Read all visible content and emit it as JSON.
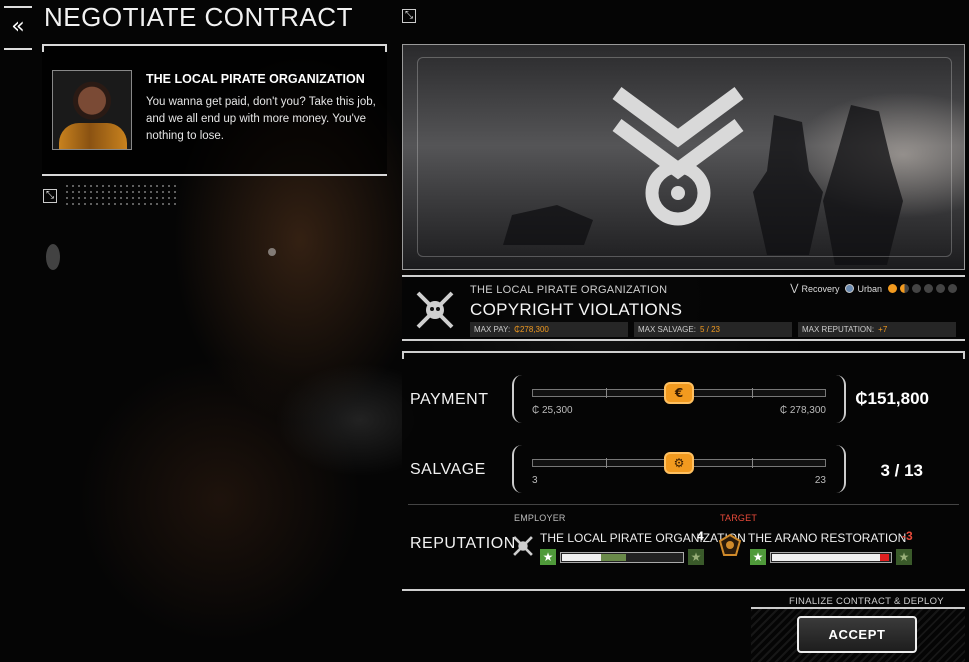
{
  "header": {
    "title": "NEGOTIATE CONTRACT",
    "back_glyph": "«"
  },
  "dialog": {
    "speaker": "THE LOCAL PIRATE ORGANIZATION",
    "text": "You wanna get paid, don't you? Take this job, and we all end up with more money. You've nothing to lose."
  },
  "contract": {
    "org": "THE LOCAL PIRATE ORGANIZATION",
    "title": "COPYRIGHT VIOLATIONS",
    "tags": {
      "type": "Recovery",
      "biome": "Urban"
    },
    "difficulty": {
      "filled": 2,
      "total": 6
    },
    "stats": {
      "max_pay_label": "MAX PAY:",
      "max_pay": "₵278,300",
      "max_salvage_label": "MAX SALVAGE:",
      "max_salvage": "5 / 23",
      "max_rep_label": "MAX REPUTATION:",
      "max_rep": "+7"
    }
  },
  "negotiation": {
    "payment": {
      "label": "PAYMENT",
      "min_label": "₵ 25,300",
      "max_label": "₵ 278,300",
      "value": "₵151,800",
      "min": 25300,
      "max": 278300,
      "current": 151800
    },
    "salvage": {
      "label": "SALVAGE",
      "min_label": "3",
      "max_label": "23",
      "value": "3 / 13",
      "min": 3,
      "max": 23,
      "current": 13
    },
    "reputation": {
      "label": "REPUTATION",
      "employer": {
        "caption": "EMPLOYER",
        "name": "THE LOCAL PIRATE ORGANIZATION",
        "change": "4",
        "level": 0.33,
        "gain": 0.2
      },
      "target": {
        "caption": "TARGET",
        "name": "THE ARANO RESTORATION",
        "change": "-3",
        "level": 0.91,
        "loss": 0.07
      }
    }
  },
  "footer": {
    "finalize_label": "FINALIZE CONTRACT & DEPLOY",
    "accept_label": "ACCEPT"
  },
  "colors": {
    "accent": "#f29a1f",
    "danger": "#e84a3a",
    "star_green": "#4f9a3a"
  }
}
